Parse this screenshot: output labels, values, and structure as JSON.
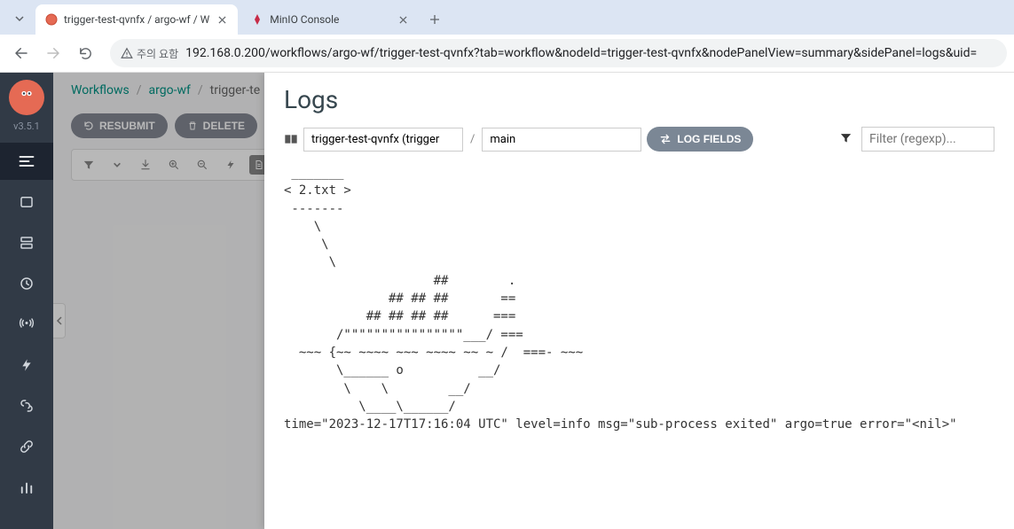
{
  "browser": {
    "tabs": [
      {
        "title": "trigger-test-qvnfx / argo-wf / W",
        "active": true
      },
      {
        "title": "MinIO Console",
        "active": false
      }
    ],
    "security_label": "주의 요함",
    "url": "192.168.0.200/workflows/argo-wf/trigger-test-qvnfx?tab=workflow&nodeId=trigger-test-qvnfx&nodePanelView=summary&sidePanel=logs&uid="
  },
  "sidebar": {
    "version": "v3.5.1"
  },
  "breadcrumb": {
    "items": [
      "Workflows",
      "argo-wf",
      "trigger-te"
    ]
  },
  "actions": {
    "resubmit": "RESUBMIT",
    "delete": "DELETE"
  },
  "logs": {
    "title": "Logs",
    "workflow_value": "trigger-test-qvnfx (trigger",
    "container_value": "main",
    "logfields_label": "LOG FIELDS",
    "filter_placeholder": "Filter (regexp)...",
    "content": " _______\n< 2.txt >\n -------\n    \\\n     \\\n      \\\n                    ##        .\n              ## ## ##       ==\n           ## ## ## ##      ===\n       /\"\"\"\"\"\"\"\"\"\"\"\"\"\"\"\"___/ ===\n  ~~~ {~~ ~~~~ ~~~ ~~~~ ~~ ~ /  ===- ~~~\n       \\______ o          __/\n        \\    \\        __/\n          \\____\\______/\ntime=\"2023-12-17T17:16:04 UTC\" level=info msg=\"sub-process exited\" argo=true error=\"<nil>\""
  }
}
